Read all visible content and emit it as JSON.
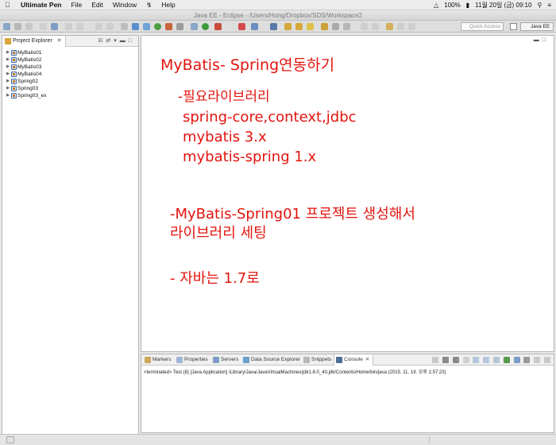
{
  "menubar": {
    "app_name": "Ultimate Pen",
    "items": [
      "File",
      "Edit",
      "Window",
      "Help"
    ],
    "battery": "100%",
    "datetime": "11월 20일 (금)  09:10"
  },
  "window": {
    "title": "Java EE - Eclipse - /Users/Hong/Dropbox/SDS/Workspace2"
  },
  "toolbar": {
    "quick_access_placeholder": "Quick Access",
    "perspective_label": "Java EE"
  },
  "explorer": {
    "tab_label": "Project Explorer",
    "projects": [
      "MyBatis01",
      "MyBatis02",
      "MyBatis03",
      "MyBatis04",
      "Spring02",
      "Spring03",
      "Spring03_ex"
    ]
  },
  "notes": {
    "title": "MyBatis- Spring연동하기",
    "libs_heading": "-필요라이브러리",
    "lib_line1": "spring-core,context,jdbc",
    "lib_line2": "mybatis 3.x",
    "lib_line3": "mybatis-spring 1.x",
    "project_line1": "-MyBatis-Spring01 프로젝트 생성해서",
    "project_line2": "라이브러리 세팅",
    "java_line": "- 자바는 1.7로"
  },
  "bottom_panel": {
    "tabs": [
      "Markers",
      "Properties",
      "Servers",
      "Data Source Explorer",
      "Snippets",
      "Console"
    ],
    "active_tab": "Console",
    "console_text": "<terminated> Test (8) [Java Application] /Library/Java/JavaVirtualMachines/jdk1.8.0_40.jdk/Contents/Home/bin/java (2015. 11. 19. 오후 1:57:23)"
  },
  "colors": {
    "annotation_red": "#e3140f",
    "menubar_bg": "#ececec",
    "panel_bg": "#ffffff"
  }
}
